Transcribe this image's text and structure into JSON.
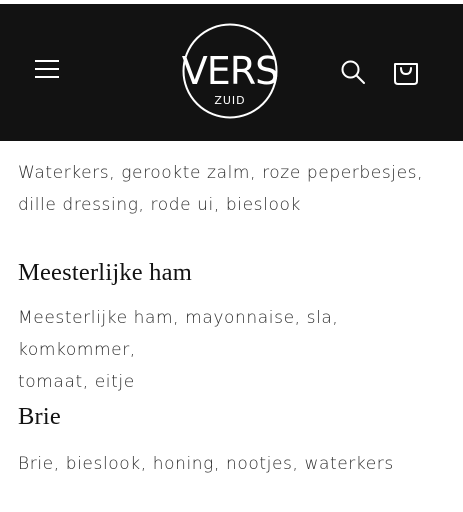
{
  "header": {
    "logo": {
      "main_text": "VERS",
      "sub_text": "ZUID"
    },
    "icons": {
      "menu": "hamburger-menu-icon",
      "search": "search-icon",
      "cart": "shopping-bag-icon"
    },
    "colors": {
      "background": "#121212",
      "foreground": "#ffffff"
    }
  },
  "menu_items": [
    {
      "title": "",
      "description_lines": [
        "Waterkers, gerookte zalm, roze peperbesjes,",
        "dille dressing, rode ui, bieslook"
      ]
    },
    {
      "title": "Meesterlijke ham",
      "description_lines": [
        "Meesterlijke ham, mayonnaise, sla, komkommer,",
        "tomaat, eitje"
      ]
    },
    {
      "title": "Brie",
      "description_lines": [
        "Brie, bieslook, honing, nootjes, waterkers"
      ]
    }
  ]
}
